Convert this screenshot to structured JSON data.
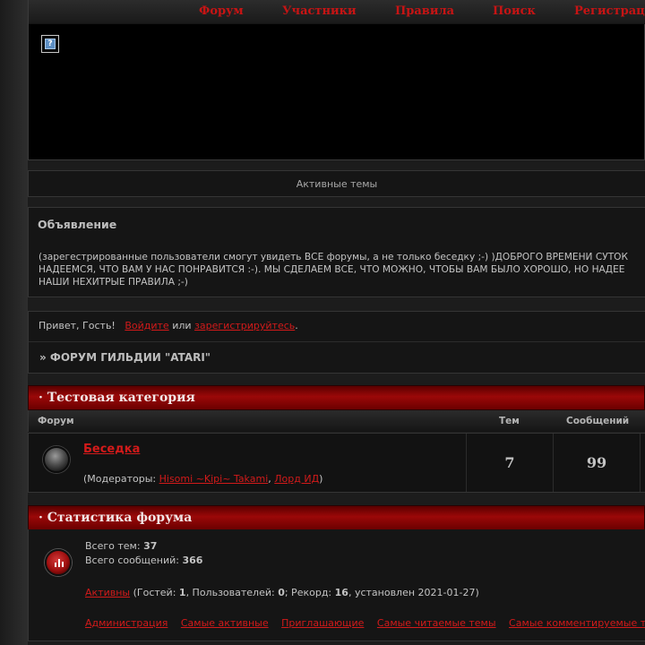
{
  "nav": {
    "forum": "Форум",
    "members": "Участники",
    "rules": "Правила",
    "search": "Поиск",
    "register": "Регистрац"
  },
  "header": {
    "logo_icon": "broken-image-icon"
  },
  "active_topics": "Активные темы",
  "announcement": {
    "title": "Объявление",
    "line1": "(зарегестрированные пользователи смогут увидеть ВСЕ форумы, а не только беседку ;-) )ДОБРОГО ВРЕМЕНИ СУТОК",
    "line2": "НАДЕЕМСЯ, ЧТО ВАМ У НАС ПОНРАВИТСЯ :-). МЫ СДЕЛАЕМ ВСЕ, ЧТО МОЖНО, ЧТОБЫ ВАМ БЫЛО ХОРОШО, НО НАДЕЕ",
    "line3": "НАШИ НЕХИТРЫЕ ПРАВИЛА ;-)"
  },
  "welcome": {
    "greeting": "Привет, Гость!",
    "login": "Войдите",
    "or": "или",
    "register": "зарегистрируйтесь",
    "dot": ".",
    "breadcrumb": "» ФОРУМ ГИЛЬДИИ \"ATARI\""
  },
  "category": {
    "title": "· Тестовая категория",
    "columns": {
      "forum": "Форум",
      "topics": "Тем",
      "posts": "Сообщений"
    },
    "forums": [
      {
        "name": "Беседка",
        "mods_prefix": "(Модераторы: ",
        "mods": [
          "Hisomi ~Kipi~ Takami",
          "Лорд ИД"
        ],
        "mods_sep": ", ",
        "mods_suffix": ")",
        "topics": "7",
        "posts": "99"
      }
    ]
  },
  "stats": {
    "title": "· Статистика форума",
    "total_topics_label": "Всего тем:",
    "total_topics": "37",
    "total_posts_label": "Всего сообщений:",
    "total_posts": "366",
    "active_link": "Активны",
    "guests_label": " (Гостей: ",
    "guests": "1",
    "users_label": ", Пользователей: ",
    "users": "0",
    "record_label": "; Рекорд: ",
    "record": "16",
    "record_date": ", установлен 2021-01-27)",
    "links": [
      "Администрация",
      "Самые активные",
      "Приглашающие",
      "Самые читаемые темы",
      "Самые комментируемые т"
    ]
  }
}
